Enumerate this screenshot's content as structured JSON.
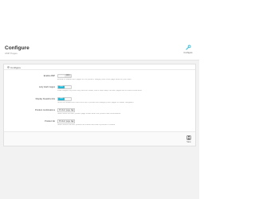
{
  "header": {
    "title": "Configure",
    "breadcrumb": "AMP Pages",
    "configure_label": "Configure",
    "icons": {
      "configure": "wrench-icon"
    }
  },
  "panel": {
    "heading": "Configure",
    "heading_icon": "gear-icon",
    "rows": [
      {
        "label": "Enable AMP",
        "control": "toggle",
        "state": "off",
        "value": "OFF",
        "help": "Enable or disable AMP pages for the product, category and home page views on your store."
      },
      {
        "label": "Lazy load images",
        "control": "toggle",
        "state": "on",
        "value": "ON",
        "help": "Load images only when they become visible, which helps keep the AMP pages fast on slow connections."
      },
      {
        "label": "Display breadcrumbs",
        "control": "toggle",
        "state": "on",
        "value": "ON",
        "help": "Show the breadcrumb trail at the top of product and category AMP pages for easier navigation."
      },
      {
        "label": "Product combinations",
        "control": "select",
        "value": "Product page link",
        "help": "Select what the AMP product page shows when the product has combinations."
      },
      {
        "label": "Product list",
        "control": "select",
        "value": "Product page link",
        "help": "Select where the AMP product list should link when a product is clicked."
      }
    ]
  },
  "footer": {
    "save_label": "Save",
    "icons": {
      "save": "floppy-disk-icon"
    }
  },
  "colors": {
    "accent": "#25b9d7",
    "background": "#f2f2f2",
    "panel": "#ffffff"
  }
}
